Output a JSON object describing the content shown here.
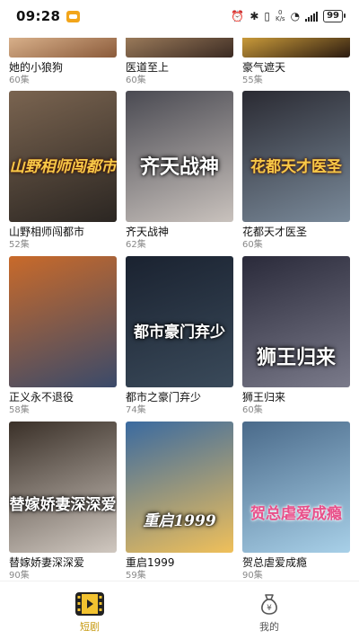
{
  "status_bar": {
    "time": "09:28",
    "network_speed_top": "0",
    "network_speed_bottom": "K/s",
    "battery": "99"
  },
  "dramas": [
    {
      "title": "她的小狼狗",
      "episodes": "60集",
      "poster_text": "",
      "palette": [
        "#8a5a3a",
        "#d8b08a"
      ]
    },
    {
      "title": "医道至上",
      "episodes": "60集",
      "poster_text": "",
      "palette": [
        "#3a2a22",
        "#9a7a5a"
      ]
    },
    {
      "title": "豪气遮天",
      "episodes": "55集",
      "poster_text": "",
      "palette": [
        "#2a1a10",
        "#c99a3a"
      ]
    },
    {
      "title": "山野相师闯都市",
      "episodes": "52集",
      "poster_text": "山野相师闯都市",
      "palette": [
        "#2b2622",
        "#7a6450"
      ]
    },
    {
      "title": "齐天战神",
      "episodes": "62集",
      "poster_text": "齐天战神",
      "palette": [
        "#c9c2bd",
        "#4a4a52"
      ]
    },
    {
      "title": "花都天才医圣",
      "episodes": "60集",
      "poster_text": "花都天才医圣",
      "palette": [
        "#7a8a9a",
        "#2a2a32"
      ]
    },
    {
      "title": "正义永不退役",
      "episodes": "58集",
      "poster_text": "",
      "palette": [
        "#3a4a6a",
        "#c96a2a"
      ]
    },
    {
      "title": "都市之豪门弃少",
      "episodes": "74集",
      "poster_text": "都市豪门弃少",
      "palette": [
        "#3a4a5a",
        "#1a2230"
      ]
    },
    {
      "title": "狮王归来",
      "episodes": "60集",
      "poster_text": "狮王归来",
      "palette": [
        "#7a7a8a",
        "#2a2a3a"
      ]
    },
    {
      "title": "替嫁娇妻深深爱",
      "episodes": "90集",
      "poster_text": "替嫁娇妻深深爱",
      "palette": [
        "#d0c8c0",
        "#3a3028"
      ]
    },
    {
      "title": "重启1999",
      "episodes": "59集",
      "poster_text": "重启1999",
      "palette": [
        "#f0c05a",
        "#3a6aa0"
      ]
    },
    {
      "title": "贺总虐爱成瘾",
      "episodes": "90集",
      "poster_text": "贺总虐爱成瘾",
      "palette": [
        "#a8d0e8",
        "#4a6a8a"
      ]
    }
  ],
  "bottom_nav": [
    {
      "label": "短剧",
      "icon": "film-icon",
      "active": true
    },
    {
      "label": "我的",
      "icon": "money-bag-icon",
      "active": false
    }
  ],
  "colors": {
    "accent": "#c79a12",
    "nav_inactive": "#555555",
    "count_text": "#888888"
  }
}
